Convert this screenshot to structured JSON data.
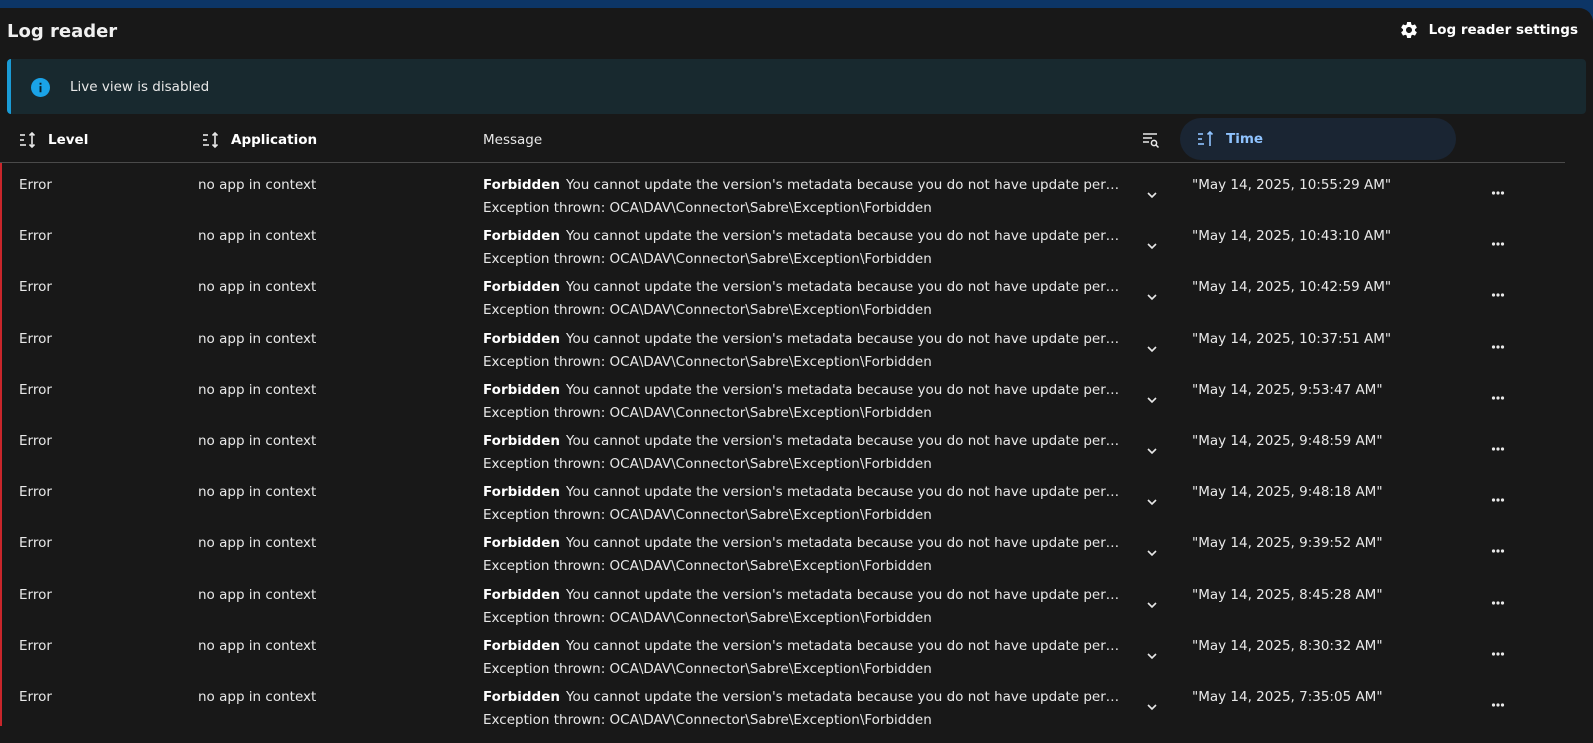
{
  "header": {
    "title": "Log reader",
    "settings_label": "Log reader settings",
    "settings_icon": "gear-icon"
  },
  "notice": {
    "text": "Live view is disabled",
    "icon": "info-icon",
    "accent": "#1a9bd6"
  },
  "columns": {
    "level": "Level",
    "application": "Application",
    "message": "Message",
    "time": "Time"
  },
  "rows": [
    {
      "level": "Error",
      "app": "no app in context",
      "msg_title": "Forbidden",
      "msg_text": "You cannot update the version's metadata because you do not have update permis…",
      "exception": "Exception thrown: OCA\\DAV\\Connector\\Sabre\\Exception\\Forbidden",
      "time": "\"May 14, 2025, 10:55:29 AM\""
    },
    {
      "level": "Error",
      "app": "no app in context",
      "msg_title": "Forbidden",
      "msg_text": "You cannot update the version's metadata because you do not have update permis…",
      "exception": "Exception thrown: OCA\\DAV\\Connector\\Sabre\\Exception\\Forbidden",
      "time": "\"May 14, 2025, 10:43:10 AM\""
    },
    {
      "level": "Error",
      "app": "no app in context",
      "msg_title": "Forbidden",
      "msg_text": "You cannot update the version's metadata because you do not have update permis…",
      "exception": "Exception thrown: OCA\\DAV\\Connector\\Sabre\\Exception\\Forbidden",
      "time": "\"May 14, 2025, 10:42:59 AM\""
    },
    {
      "level": "Error",
      "app": "no app in context",
      "msg_title": "Forbidden",
      "msg_text": "You cannot update the version's metadata because you do not have update permis…",
      "exception": "Exception thrown: OCA\\DAV\\Connector\\Sabre\\Exception\\Forbidden",
      "time": "\"May 14, 2025, 10:37:51 AM\""
    },
    {
      "level": "Error",
      "app": "no app in context",
      "msg_title": "Forbidden",
      "msg_text": "You cannot update the version's metadata because you do not have update permis…",
      "exception": "Exception thrown: OCA\\DAV\\Connector\\Sabre\\Exception\\Forbidden",
      "time": "\"May 14, 2025, 9:53:47 AM\""
    },
    {
      "level": "Error",
      "app": "no app in context",
      "msg_title": "Forbidden",
      "msg_text": "You cannot update the version's metadata because you do not have update permis…",
      "exception": "Exception thrown: OCA\\DAV\\Connector\\Sabre\\Exception\\Forbidden",
      "time": "\"May 14, 2025, 9:48:59 AM\""
    },
    {
      "level": "Error",
      "app": "no app in context",
      "msg_title": "Forbidden",
      "msg_text": "You cannot update the version's metadata because you do not have update permis…",
      "exception": "Exception thrown: OCA\\DAV\\Connector\\Sabre\\Exception\\Forbidden",
      "time": "\"May 14, 2025, 9:48:18 AM\""
    },
    {
      "level": "Error",
      "app": "no app in context",
      "msg_title": "Forbidden",
      "msg_text": "You cannot update the version's metadata because you do not have update permis…",
      "exception": "Exception thrown: OCA\\DAV\\Connector\\Sabre\\Exception\\Forbidden",
      "time": "\"May 14, 2025, 9:39:52 AM\""
    },
    {
      "level": "Error",
      "app": "no app in context",
      "msg_title": "Forbidden",
      "msg_text": "You cannot update the version's metadata because you do not have update permis…",
      "exception": "Exception thrown: OCA\\DAV\\Connector\\Sabre\\Exception\\Forbidden",
      "time": "\"May 14, 2025, 8:45:28 AM\""
    },
    {
      "level": "Error",
      "app": "no app in context",
      "msg_title": "Forbidden",
      "msg_text": "You cannot update the version's metadata because you do not have update permis…",
      "exception": "Exception thrown: OCA\\DAV\\Connector\\Sabre\\Exception\\Forbidden",
      "time": "\"May 14, 2025, 8:30:32 AM\""
    },
    {
      "level": "Error",
      "app": "no app in context",
      "msg_title": "Forbidden",
      "msg_text": "You cannot update the version's metadata because you do not have update permis…",
      "exception": "Exception thrown: OCA\\DAV\\Connector\\Sabre\\Exception\\Forbidden",
      "time": "\"May 14, 2025, 7:35:05 AM\""
    }
  ],
  "colors": {
    "error_stripe": "#c8262b",
    "active_sort": "#8fc3ff"
  }
}
